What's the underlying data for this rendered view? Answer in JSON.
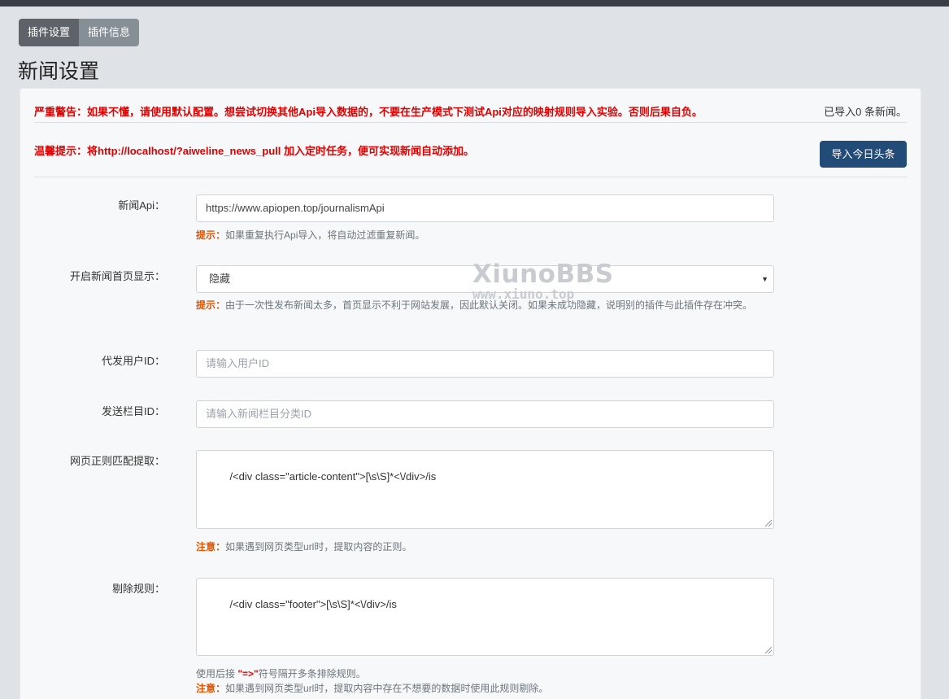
{
  "tabs": [
    {
      "label": "插件设置",
      "active": true
    },
    {
      "label": "插件信息",
      "active": false
    }
  ],
  "page_title": "新闻设置",
  "warning": "严重警告：如果不懂，请使用默认配置。想尝试切换其他Api导入数据的，不要在生产模式下测试Api对应的映射规则导入实验。否则后果自负。",
  "import_count": "已导入0 条新闻。",
  "tip": "温馨提示：将http://localhost/?aiweline_news_pull 加入定时任务，便可实现新闻自动添加。",
  "import_button": "导入今日头条",
  "watermark": {
    "title": "XiunoBBS",
    "url": "www.xiuno.top"
  },
  "form": {
    "api": {
      "label": "新闻Api：",
      "value": "https://www.apiopen.top/journalismApi",
      "help_key": "提示：",
      "help": "如果重复执行Api导入，将自动过滤重复新闻。"
    },
    "homepage": {
      "label": "开启新闻首页显示：",
      "selected": "隐藏",
      "help_key": "提示：",
      "help": "由于一次性发布新闻太多，首页显示不利于网站发展，因此默认关闭。如果未成功隐藏，说明别的插件与此插件存在冲突。"
    },
    "user_id": {
      "label": "代发用户ID：",
      "placeholder": "请输入用户ID"
    },
    "category_id": {
      "label": "发送栏目ID：",
      "placeholder": "请输入新闻栏目分类ID"
    },
    "regex": {
      "label": "网页正则匹配提取：",
      "value": "/<div class=\"article-content\">[\\s\\S]*<\\/div>/is",
      "help_key": "注意：",
      "help": "如果遇到网页类型url时，提取内容的正则。"
    },
    "remove": {
      "label": "剔除规则：",
      "value": "/<div class=\"footer\">[\\s\\S]*<\\/div>/is",
      "help_line1_pre": "使用后接 ",
      "help_line1_quote": "\"=>\"",
      "help_line1_post": "符号隔开多条排除规则。",
      "help_key": "注意：",
      "help": "如果遇到网页类型url时，提取内容中存在不想要的数据时使用此规则剔除。"
    }
  }
}
